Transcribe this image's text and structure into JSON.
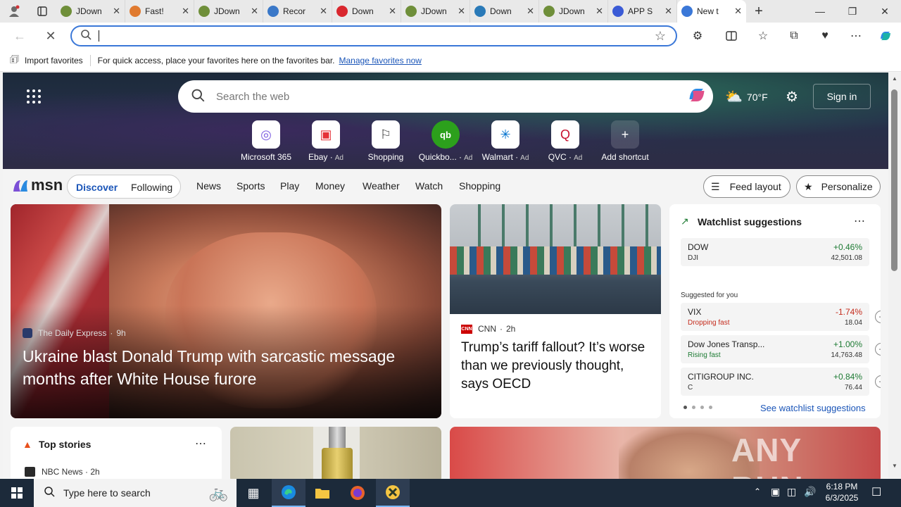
{
  "browser": {
    "tabs": [
      {
        "label": "JDown",
        "icon": "jdownloader-icon",
        "color": "#6f8f3a"
      },
      {
        "label": "Fast!",
        "icon": "rocket-icon",
        "color": "#e07a2f"
      },
      {
        "label": "JDown",
        "icon": "jdownloader-icon",
        "color": "#6f8f3a"
      },
      {
        "label": "Recor",
        "icon": "link-icon",
        "color": "#3a78c8"
      },
      {
        "label": "Down",
        "icon": "mega-icon",
        "color": "#d9272e"
      },
      {
        "label": "JDown",
        "icon": "jdownloader-icon",
        "color": "#6f8f3a"
      },
      {
        "label": "Down",
        "icon": "globe-icon",
        "color": "#2a7ab8"
      },
      {
        "label": "JDown",
        "icon": "jdownloader-icon",
        "color": "#6f8f3a"
      },
      {
        "label": "APP S",
        "icon": "app-icon",
        "color": "#3b5bd6"
      },
      {
        "label": "New t",
        "icon": "loading-icon",
        "color": "#3b78d8",
        "active": true
      }
    ],
    "address_value": "",
    "favorites_bar": {
      "import_label": "Import favorites",
      "hint": "For quick access, place your favorites here on the favorites bar.",
      "manage_link": "Manage favorites now"
    }
  },
  "newtab": {
    "search_placeholder": "Search the web",
    "weather": "70°F",
    "sign_in": "Sign in",
    "shortcuts": [
      {
        "label": "Microsoft 365",
        "icon": "microsoft365-icon"
      },
      {
        "label": "Ebay",
        "ad": "Ad",
        "icon": "ebay-icon"
      },
      {
        "label": "Shopping",
        "ad": "",
        "icon": "tag-icon"
      },
      {
        "label": "Quickbo...",
        "ad": "Ad",
        "icon": "quickbooks-icon"
      },
      {
        "label": "Walmart",
        "ad": "Ad",
        "icon": "walmart-icon"
      },
      {
        "label": "QVC",
        "ad": "Ad",
        "icon": "qvc-icon"
      },
      {
        "label": "Add shortcut",
        "icon": "plus-icon"
      }
    ]
  },
  "msn": {
    "logo": "msn",
    "tabs": [
      "Discover",
      "Following"
    ],
    "nav": [
      "News",
      "Sports",
      "Play",
      "Money",
      "Weather",
      "Watch",
      "Shopping"
    ],
    "feed_layout": "Feed layout",
    "personalize": "Personalize"
  },
  "main_story": {
    "source": "The Daily Express",
    "age": "9h",
    "headline": "Ukraine blast Donald Trump with sarcastic message months after White House furore"
  },
  "cnn_story": {
    "source": "CNN",
    "age": "2h",
    "headline": "Trump’s tariff fallout? It’s worse than we previously thought, says OECD"
  },
  "watchlist": {
    "title": "Watchlist suggestions",
    "dow": {
      "name": "DOW",
      "ticker": "DJI",
      "change": "+0.46%",
      "value": "42,501.08"
    },
    "suggested_label": "Suggested for you",
    "items": [
      {
        "name": "VIX",
        "sub": "Dropping fast",
        "change": "-1.74%",
        "value": "18.04",
        "neg": true
      },
      {
        "name": "Dow Jones Transp...",
        "sub": "Rising fast",
        "change": "+1.00%",
        "value": "14,763.48",
        "neg": false
      },
      {
        "name": "CITIGROUP INC.",
        "sub": "C",
        "change": "+0.84%",
        "value": "76.44",
        "neg": false
      }
    ],
    "see_more": "See watchlist suggestions"
  },
  "top_stories": {
    "title": "Top stories",
    "first_source": "NBC News",
    "first_age": "2h"
  },
  "watermark": "ANY RUN",
  "taskbar": {
    "search_placeholder": "Type here to search",
    "time": "6:18 PM",
    "date": "6/3/2025"
  },
  "colors": {
    "accent": "#3b78d8",
    "positive": "#1e7b34",
    "negative": "#c42b1c"
  }
}
